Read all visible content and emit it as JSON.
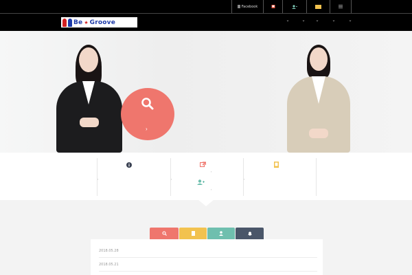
{
  "topbar": {
    "facebook_label": "Facebook",
    "icons": [
      "facebook-icon",
      "mail-icon",
      "user-add-icon",
      "folder-icon",
      "menu-icon"
    ]
  },
  "header": {
    "logo_text": "Be",
    "logo_text_2": "Groove",
    "nav_icons": [
      "chevron-down-icon",
      "chevron-down-icon",
      "chevron-down-icon",
      "chevron-down-icon",
      "chevron-down-icon"
    ]
  },
  "hero": {
    "search_chevron": "›"
  },
  "info": {
    "arrow": "›"
  },
  "tabs": [
    "search-icon",
    "book-icon",
    "user-icon",
    "bell-icon"
  ],
  "news": {
    "items": [
      {
        "date": "2018.05.28"
      },
      {
        "date": "2018.05.21"
      }
    ]
  },
  "colors": {
    "coral": "#ef766d",
    "yellow": "#f2c24f",
    "teal": "#6fbfae",
    "navy": "#4a5669"
  }
}
